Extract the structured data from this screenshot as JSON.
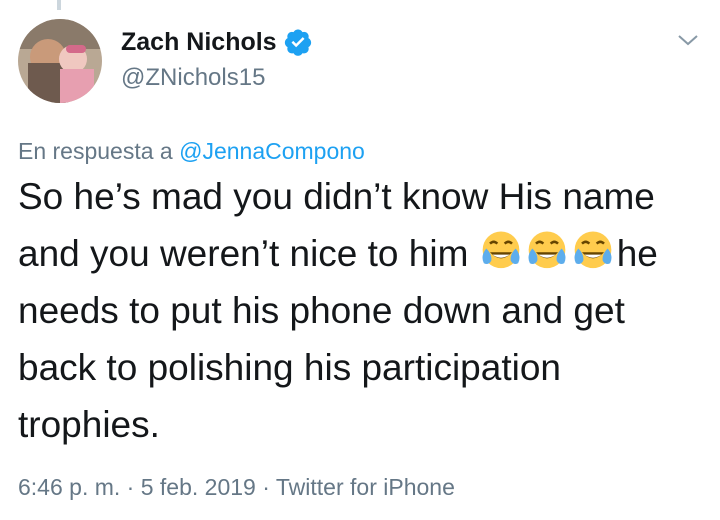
{
  "author": {
    "name": "Zach Nichols",
    "handle": "@ZNichols15",
    "verified": true,
    "avatar_icon": "avatar-photo"
  },
  "reply": {
    "prefix": "En respuesta a",
    "target": "@JennaCompono"
  },
  "tweet": {
    "line1": "So he’s mad you didn’t know His name and you weren’t nice to him",
    "emojis": [
      "face-with-tears-of-joy",
      "face-with-tears-of-joy",
      "face-with-tears-of-joy"
    ],
    "line2": "he needs to put his phone down and get back to polishing his participation trophies."
  },
  "meta": {
    "time": "6:46 p. m.",
    "date": "5 feb. 2019",
    "source": "Twitter for iPhone",
    "separator": "·"
  },
  "colors": {
    "text": "#14171a",
    "secondary": "#657786",
    "link": "#1da1f2"
  }
}
